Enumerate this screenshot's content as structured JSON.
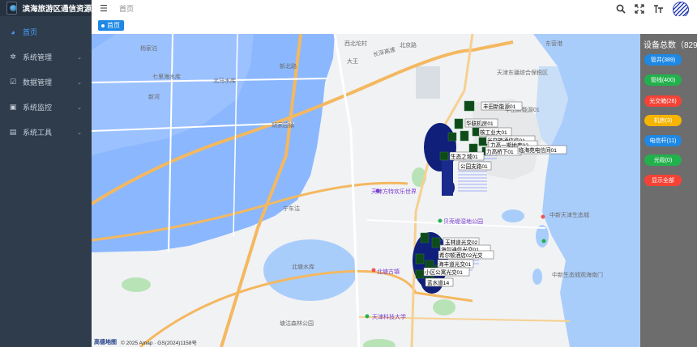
{
  "app": {
    "title": "滨海旅游区通信资源"
  },
  "sidebar": {
    "items": [
      {
        "label": "首页",
        "icon": "dashboard-icon",
        "active": true
      },
      {
        "label": "系统管理",
        "icon": "gear-icon",
        "active": false
      },
      {
        "label": "数据管理",
        "icon": "checkbox-icon",
        "active": false
      },
      {
        "label": "系统监控",
        "icon": "monitor-icon",
        "active": false
      },
      {
        "label": "系统工具",
        "icon": "toolbox-icon",
        "active": false
      }
    ]
  },
  "header": {
    "breadcrumb": "首页"
  },
  "tags": {
    "home": "首页"
  },
  "panel": {
    "title": "设备总数（829）",
    "buttons": [
      {
        "label": "管井(389)",
        "color": "#1e88e5"
      },
      {
        "label": "管线(400)",
        "color": "#22b14c"
      },
      {
        "label": "光交箱(26)",
        "color": "#f44336"
      },
      {
        "label": "机房(3)",
        "color": "#f5b400"
      },
      {
        "label": "电信杆(11)",
        "color": "#1e88e5"
      },
      {
        "label": "光缆(0)",
        "color": "#22b14c"
      },
      {
        "label": "显示全部",
        "color": "#f44336"
      }
    ]
  },
  "map": {
    "places": [
      {
        "text": "西北坨村"
      },
      {
        "text": "北京路"
      },
      {
        "text": "长深高速"
      },
      {
        "text": "东营港"
      },
      {
        "text": "大王"
      },
      {
        "text": "七里海水库"
      },
      {
        "text": "北马水库"
      },
      {
        "text": "新北路"
      },
      {
        "text": "胡家园镇"
      },
      {
        "text": "天津东疆综合保税区"
      },
      {
        "text": "丰田新能源01"
      },
      {
        "text": "天津方特欢乐世界"
      },
      {
        "text": "贝壳堤湿地公园"
      },
      {
        "text": "北塘水库"
      },
      {
        "text": "北塘古镇"
      },
      {
        "text": "天津科技大学"
      },
      {
        "text": "中新天津生态城"
      },
      {
        "text": "中新生态城观海南门"
      },
      {
        "text": "宁车沽"
      },
      {
        "text": "塘沽森林公园"
      },
      {
        "text": "新河"
      },
      {
        "text": "杨家泊"
      }
    ],
    "device_labels": [
      "丰田新能源01",
      "华联机房01",
      "核工业大01",
      "光交箱通信信01",
      "力高一期地库02",
      "力高桥下01",
      "临海苑电信间01",
      "生态之城01",
      "公园支路01",
      "玉林道光交02",
      "海尔通信光交01",
      "希尔顿酒店02光交",
      "海丰道光交01",
      "小区公寓光交01",
      "蓝水道14"
    ],
    "attribution": {
      "brand": "高德地图",
      "text": "© 2025 Amap · GS(2024)1158号"
    }
  }
}
